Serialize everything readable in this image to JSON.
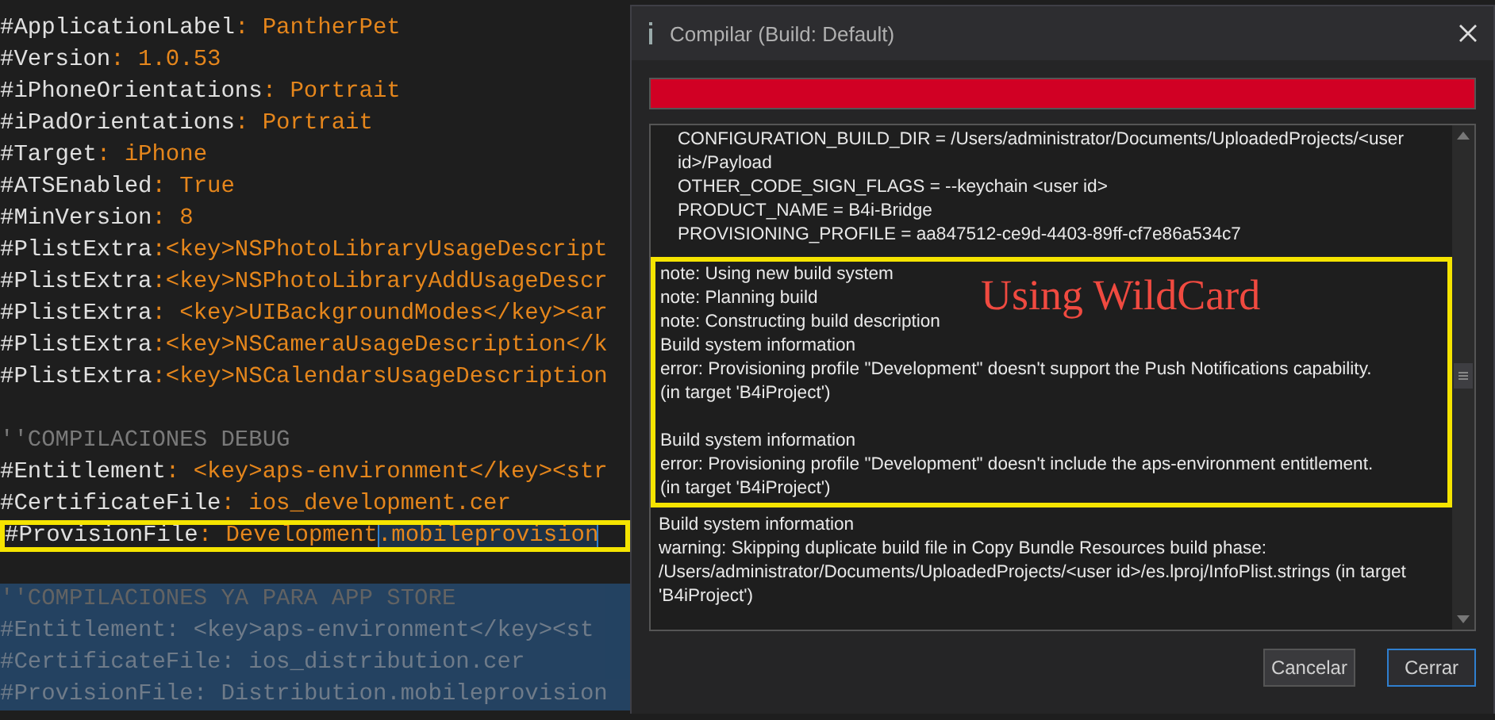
{
  "editor": {
    "lines": [
      {
        "kind": "attr",
        "key": "#ApplicationLabel",
        "value": ": PantherPet",
        "selected": false,
        "highlighted": false
      },
      {
        "kind": "attr",
        "key": "#Version",
        "value": ": 1.0.53",
        "selected": false,
        "highlighted": false
      },
      {
        "kind": "attr",
        "key": "#iPhoneOrientations",
        "value": ": Portrait",
        "selected": false,
        "highlighted": false
      },
      {
        "kind": "attr",
        "key": "#iPadOrientations",
        "value": ": Portrait",
        "selected": false,
        "highlighted": false
      },
      {
        "kind": "attr",
        "key": "#Target",
        "value": ": iPhone",
        "selected": false,
        "highlighted": false
      },
      {
        "kind": "attr",
        "key": "#ATSEnabled",
        "value": ": True",
        "selected": false,
        "highlighted": false
      },
      {
        "kind": "attr",
        "key": "#MinVersion",
        "value": ": 8",
        "selected": false,
        "highlighted": false
      },
      {
        "kind": "attr",
        "key": "#PlistExtra",
        "value": ":<key>NSPhotoLibraryUsageDescript",
        "selected": false,
        "highlighted": false
      },
      {
        "kind": "attr",
        "key": "#PlistExtra",
        "value": ":<key>NSPhotoLibraryAddUsageDescr",
        "selected": false,
        "highlighted": false
      },
      {
        "kind": "attr",
        "key": "#PlistExtra",
        "value": ": <key>UIBackgroundModes</key><ar",
        "selected": false,
        "highlighted": false
      },
      {
        "kind": "attr",
        "key": "#PlistExtra",
        "value": ":<key>NSCameraUsageDescription</k",
        "selected": false,
        "highlighted": false
      },
      {
        "kind": "attr",
        "key": "#PlistExtra",
        "value": ":<key>NSCalendarsUsageDescription",
        "selected": false,
        "highlighted": false
      },
      {
        "kind": "comment",
        "text": "''COMPILACIONES DEBUG",
        "selected": false,
        "highlighted": false
      },
      {
        "kind": "attr",
        "key": "#Entitlement",
        "value": ": <key>aps-environment</key><str",
        "selected": false,
        "highlighted": false
      },
      {
        "kind": "attr",
        "key": "#CertificateFile",
        "value": ": ios_development.cer",
        "selected": false,
        "highlighted": false
      },
      {
        "kind": "attr",
        "key": "#ProvisionFile",
        "value": ": Development",
        "match": ".mobileprovision",
        "selected": false,
        "highlighted": true
      },
      {
        "kind": "comment",
        "text": "''COMPILACIONES YA PARA APP STORE",
        "selected": true,
        "highlighted": false
      },
      {
        "kind": "attr",
        "key": " #Entitlement",
        "value": ": <key>aps-environment</key><st",
        "selected": true,
        "highlighted": false
      },
      {
        "kind": "attr",
        "key": "#CertificateFile",
        "value": ": ios_distribution.cer",
        "selected": true,
        "highlighted": false
      },
      {
        "kind": "attr",
        "key": "#ProvisionFile",
        "value": ": Distribution.mobileprovision",
        "selected": true,
        "highlighted": false
      }
    ]
  },
  "dialog": {
    "title": "Compilar (Build: Default)",
    "progress": {
      "level": 1
    },
    "log": [
      {
        "highlighted": false,
        "entries": [
          {
            "kind": "setting",
            "text": "CONFIGURATION_BUILD_DIR = /Users/administrator/Documents/UploadedProjects/<user id>/Payload"
          },
          {
            "kind": "setting",
            "text": "OTHER_CODE_SIGN_FLAGS = --keychain <user id>"
          },
          {
            "kind": "setting",
            "text": "PRODUCT_NAME = B4i-Bridge"
          },
          {
            "kind": "setting",
            "text": "PROVISIONING_PROFILE = aa847512-ce9d-4403-89ff-cf7e86a534c7"
          }
        ]
      },
      {
        "highlighted": true,
        "annotation": "Using WildCard",
        "entries": [
          {
            "kind": "message",
            "text": "note: Using new build system"
          },
          {
            "kind": "message",
            "text": "note: Planning build"
          },
          {
            "kind": "message",
            "text": "note: Constructing build description"
          },
          {
            "kind": "message",
            "text": "Build system information"
          },
          {
            "kind": "message",
            "text": "error: Provisioning profile \"Development\" doesn't support the Push Notifications capability."
          },
          {
            "kind": "message",
            "text": "(in target 'B4iProject')"
          },
          {
            "kind": "gap"
          },
          {
            "kind": "message",
            "text": "Build system information"
          },
          {
            "kind": "message",
            "text": "error: Provisioning profile \"Development\" doesn't include the aps-environment entitlement."
          },
          {
            "kind": "message",
            "text": "(in target 'B4iProject')"
          }
        ]
      },
      {
        "highlighted": false,
        "entries": [
          {
            "kind": "message",
            "text": "Build system information"
          },
          {
            "kind": "message",
            "text": "warning: Skipping duplicate build file in Copy Bundle Resources build phase: /Users/administrator/Documents/UploadedProjects/<user id>/es.lproj/InfoPlist.strings (in target 'B4iProject')"
          }
        ]
      }
    ],
    "buttons": [
      {
        "label": "Cancelar",
        "default": false
      },
      {
        "label": "Cerrar",
        "default": true
      }
    ]
  }
}
